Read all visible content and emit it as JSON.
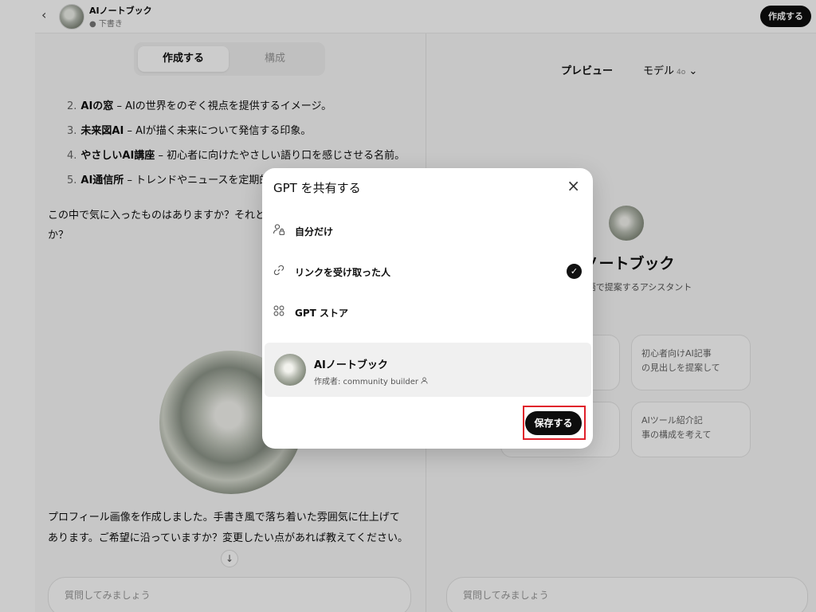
{
  "header": {
    "back_icon": "chevron-left-icon",
    "gpt_name": "AIノートブック",
    "status": "● 下書き",
    "create_label": "作成する"
  },
  "left": {
    "tabs": {
      "create": "作成する",
      "configure": "構成"
    },
    "list": [
      {
        "num": "2.",
        "bold": "AIの窓",
        "text": " – AIの世界をのぞく視点を提供するイメージ。"
      },
      {
        "num": "3.",
        "bold": "未来図AI",
        "text": " – AIが描く未来について発信する印象。"
      },
      {
        "num": "4.",
        "bold": "やさしいAI講座",
        "text": " – 初心者に向けたやさしい語り口を感じさせる名前。"
      },
      {
        "num": "5.",
        "bold": "AI通信所",
        "text": " – トレンドやニュースを定期的"
      }
    ],
    "question_line1": "この中で気に入ったものはありますか？それと",
    "question_line2": "か？",
    "reply_line1": "プロフィール画像を作成しました。手書き風で落ち着いた雰囲気に仕上げて",
    "reply_line2": "あります。ご希望に沿っていますか？変更したい点があれば教えてください。",
    "input_placeholder": "質問してみましょう",
    "scroll_icon": "arrow-down-icon"
  },
  "right": {
    "preview": "プレビュー",
    "model_label": "モデル",
    "model_value": "4o",
    "model_chevron": "chevron-down-icon",
    "gpt_name_partial": "Iノートブック",
    "description_partial": "を日本語で提案するアシスタント",
    "starters": [
      {
        "line1": "",
        "line2": ""
      },
      {
        "line1": "初心者向けAI記事",
        "line2": "の見出しを提案して"
      },
      {
        "line1": "",
        "line2": ""
      },
      {
        "line1": "AIツール紹介記",
        "line2": "事の構成を考えて"
      }
    ],
    "input_placeholder": "質問してみましょう"
  },
  "modal": {
    "title": "GPT を共有する",
    "close_icon": "close-icon",
    "options": [
      {
        "label": "自分だけ",
        "icon": "person-lock-icon",
        "selected": false
      },
      {
        "label": "リンクを受け取った人",
        "icon": "link-icon",
        "selected": true
      },
      {
        "label": "GPT ストア",
        "icon": "grid-icon",
        "selected": false
      }
    ],
    "gpt_card": {
      "name": "AIノートブック",
      "author": "作成者: community builder",
      "author_icon": "person-icon"
    },
    "save_label": "保存する",
    "highlight_color": "#e0202b"
  }
}
